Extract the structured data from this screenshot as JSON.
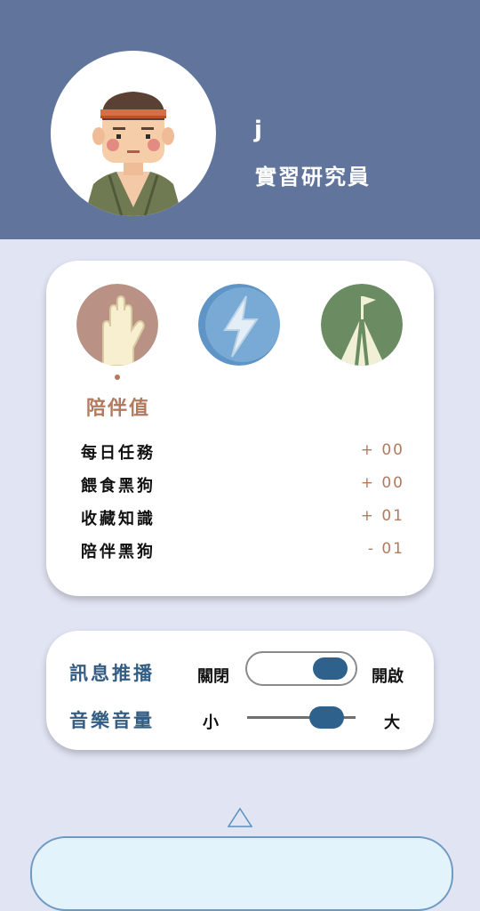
{
  "profile": {
    "username": "j",
    "role": "實習研究員"
  },
  "stats": {
    "categories": [
      {
        "icon": "raised-hand-icon",
        "color": "#b99185"
      },
      {
        "icon": "lightning-icon",
        "color": "#5f94c6"
      },
      {
        "icon": "summit-flag-icon",
        "color": "#6b8c63"
      }
    ],
    "selected_title": "陪伴值",
    "rows": [
      {
        "label": "每日任務",
        "value": "+ 00"
      },
      {
        "label": "餵食黑狗",
        "value": "+ 00"
      },
      {
        "label": "收藏知識",
        "value": "+ 01"
      },
      {
        "label": "陪伴黑狗",
        "value": "- 01"
      }
    ]
  },
  "settings": {
    "notification": {
      "label": "訊息推播",
      "off_label": "關閉",
      "on_label": "開啟",
      "state": "on"
    },
    "volume": {
      "label": "音樂音量",
      "min_label": "小",
      "max_label": "大",
      "level": 0.8
    }
  },
  "colors": {
    "header_bg": "#60749c",
    "page_bg": "#e1e4f2",
    "accent": "#2e618c",
    "stat_accent": "#b27a5f",
    "settings_label": "#345d84"
  }
}
